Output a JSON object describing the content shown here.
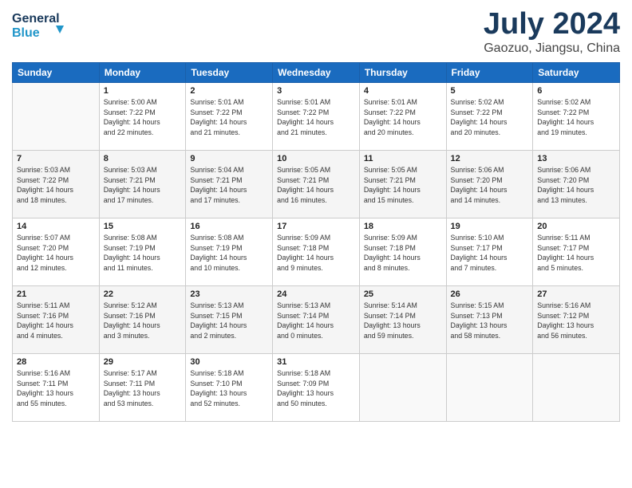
{
  "header": {
    "logo_general": "General",
    "logo_blue": "Blue",
    "title": "July 2024",
    "location": "Gaozuo, Jiangsu, China"
  },
  "weekdays": [
    "Sunday",
    "Monday",
    "Tuesday",
    "Wednesday",
    "Thursday",
    "Friday",
    "Saturday"
  ],
  "weeks": [
    [
      {
        "day": "",
        "info": ""
      },
      {
        "day": "1",
        "info": "Sunrise: 5:00 AM\nSunset: 7:22 PM\nDaylight: 14 hours\nand 22 minutes."
      },
      {
        "day": "2",
        "info": "Sunrise: 5:01 AM\nSunset: 7:22 PM\nDaylight: 14 hours\nand 21 minutes."
      },
      {
        "day": "3",
        "info": "Sunrise: 5:01 AM\nSunset: 7:22 PM\nDaylight: 14 hours\nand 21 minutes."
      },
      {
        "day": "4",
        "info": "Sunrise: 5:01 AM\nSunset: 7:22 PM\nDaylight: 14 hours\nand 20 minutes."
      },
      {
        "day": "5",
        "info": "Sunrise: 5:02 AM\nSunset: 7:22 PM\nDaylight: 14 hours\nand 20 minutes."
      },
      {
        "day": "6",
        "info": "Sunrise: 5:02 AM\nSunset: 7:22 PM\nDaylight: 14 hours\nand 19 minutes."
      }
    ],
    [
      {
        "day": "7",
        "info": "Sunrise: 5:03 AM\nSunset: 7:22 PM\nDaylight: 14 hours\nand 18 minutes."
      },
      {
        "day": "8",
        "info": "Sunrise: 5:03 AM\nSunset: 7:21 PM\nDaylight: 14 hours\nand 17 minutes."
      },
      {
        "day": "9",
        "info": "Sunrise: 5:04 AM\nSunset: 7:21 PM\nDaylight: 14 hours\nand 17 minutes."
      },
      {
        "day": "10",
        "info": "Sunrise: 5:05 AM\nSunset: 7:21 PM\nDaylight: 14 hours\nand 16 minutes."
      },
      {
        "day": "11",
        "info": "Sunrise: 5:05 AM\nSunset: 7:21 PM\nDaylight: 14 hours\nand 15 minutes."
      },
      {
        "day": "12",
        "info": "Sunrise: 5:06 AM\nSunset: 7:20 PM\nDaylight: 14 hours\nand 14 minutes."
      },
      {
        "day": "13",
        "info": "Sunrise: 5:06 AM\nSunset: 7:20 PM\nDaylight: 14 hours\nand 13 minutes."
      }
    ],
    [
      {
        "day": "14",
        "info": "Sunrise: 5:07 AM\nSunset: 7:20 PM\nDaylight: 14 hours\nand 12 minutes."
      },
      {
        "day": "15",
        "info": "Sunrise: 5:08 AM\nSunset: 7:19 PM\nDaylight: 14 hours\nand 11 minutes."
      },
      {
        "day": "16",
        "info": "Sunrise: 5:08 AM\nSunset: 7:19 PM\nDaylight: 14 hours\nand 10 minutes."
      },
      {
        "day": "17",
        "info": "Sunrise: 5:09 AM\nSunset: 7:18 PM\nDaylight: 14 hours\nand 9 minutes."
      },
      {
        "day": "18",
        "info": "Sunrise: 5:09 AM\nSunset: 7:18 PM\nDaylight: 14 hours\nand 8 minutes."
      },
      {
        "day": "19",
        "info": "Sunrise: 5:10 AM\nSunset: 7:17 PM\nDaylight: 14 hours\nand 7 minutes."
      },
      {
        "day": "20",
        "info": "Sunrise: 5:11 AM\nSunset: 7:17 PM\nDaylight: 14 hours\nand 5 minutes."
      }
    ],
    [
      {
        "day": "21",
        "info": "Sunrise: 5:11 AM\nSunset: 7:16 PM\nDaylight: 14 hours\nand 4 minutes."
      },
      {
        "day": "22",
        "info": "Sunrise: 5:12 AM\nSunset: 7:16 PM\nDaylight: 14 hours\nand 3 minutes."
      },
      {
        "day": "23",
        "info": "Sunrise: 5:13 AM\nSunset: 7:15 PM\nDaylight: 14 hours\nand 2 minutes."
      },
      {
        "day": "24",
        "info": "Sunrise: 5:13 AM\nSunset: 7:14 PM\nDaylight: 14 hours\nand 0 minutes."
      },
      {
        "day": "25",
        "info": "Sunrise: 5:14 AM\nSunset: 7:14 PM\nDaylight: 13 hours\nand 59 minutes."
      },
      {
        "day": "26",
        "info": "Sunrise: 5:15 AM\nSunset: 7:13 PM\nDaylight: 13 hours\nand 58 minutes."
      },
      {
        "day": "27",
        "info": "Sunrise: 5:16 AM\nSunset: 7:12 PM\nDaylight: 13 hours\nand 56 minutes."
      }
    ],
    [
      {
        "day": "28",
        "info": "Sunrise: 5:16 AM\nSunset: 7:11 PM\nDaylight: 13 hours\nand 55 minutes."
      },
      {
        "day": "29",
        "info": "Sunrise: 5:17 AM\nSunset: 7:11 PM\nDaylight: 13 hours\nand 53 minutes."
      },
      {
        "day": "30",
        "info": "Sunrise: 5:18 AM\nSunset: 7:10 PM\nDaylight: 13 hours\nand 52 minutes."
      },
      {
        "day": "31",
        "info": "Sunrise: 5:18 AM\nSunset: 7:09 PM\nDaylight: 13 hours\nand 50 minutes."
      },
      {
        "day": "",
        "info": ""
      },
      {
        "day": "",
        "info": ""
      },
      {
        "day": "",
        "info": ""
      }
    ]
  ]
}
